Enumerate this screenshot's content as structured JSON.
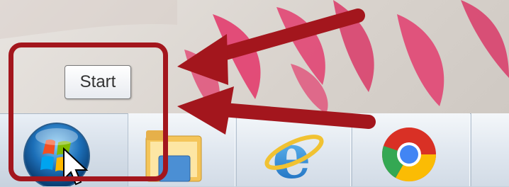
{
  "tooltip": {
    "text": "Start"
  },
  "taskbar": {
    "start_orb": "windows-start-orb-icon",
    "pinned": [
      {
        "name": "windows-explorer-icon"
      },
      {
        "name": "internet-explorer-icon"
      },
      {
        "name": "google-chrome-icon"
      }
    ]
  },
  "colors": {
    "annotation_red": "#a3161d",
    "taskbar_top": "#e9eff6",
    "wallpaper_pink": "#e23d6e"
  }
}
